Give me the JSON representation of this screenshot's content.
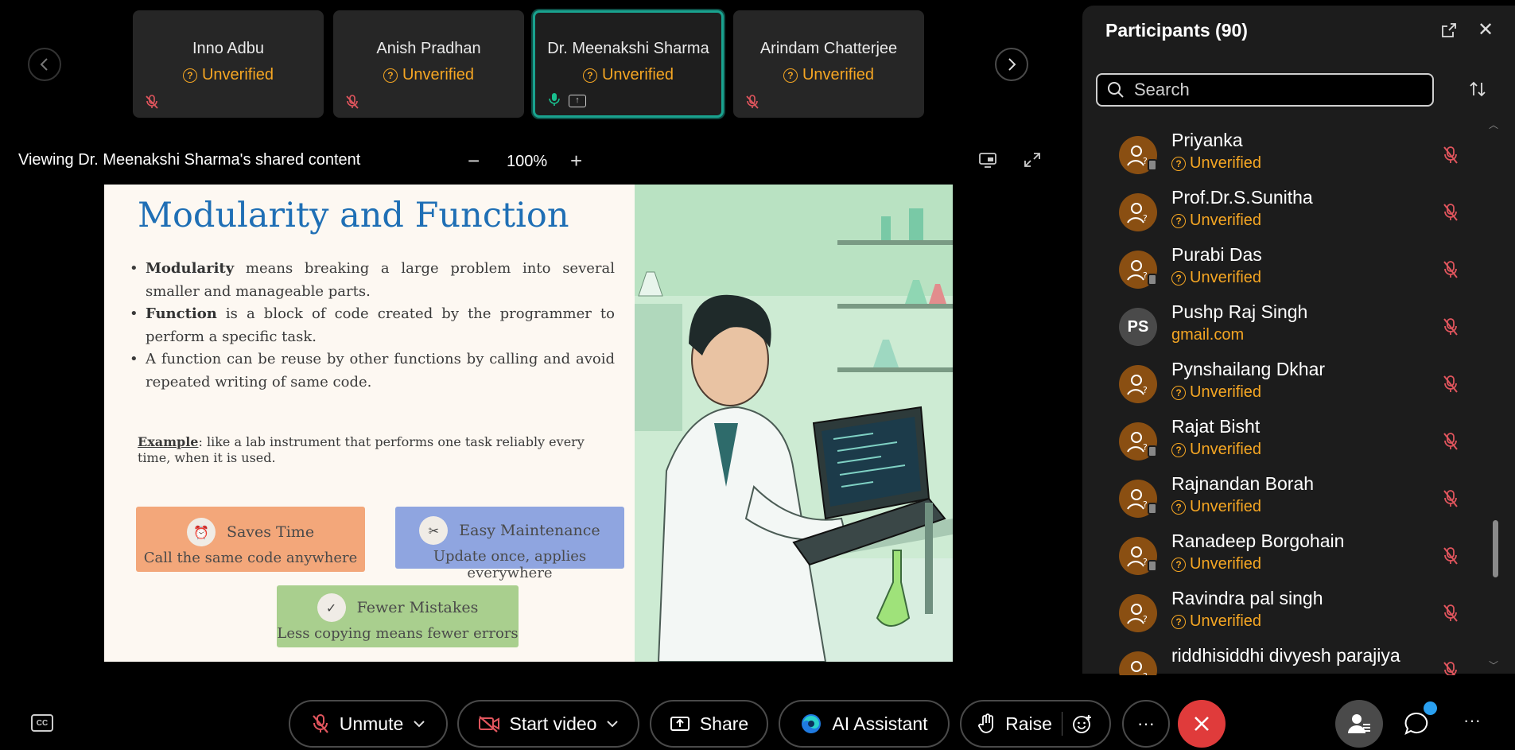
{
  "video_strip": {
    "tiles": [
      {
        "name": "Inno Adbu",
        "status": "Unverified"
      },
      {
        "name": "Anish Pradhan",
        "status": "Unverified"
      },
      {
        "name": "Dr. Meenakshi Sharma",
        "status": "Unverified"
      },
      {
        "name": "Arindam Chatterjee",
        "status": "Unverified"
      }
    ]
  },
  "share_header": {
    "title": "Viewing Dr. Meenakshi Sharma's shared content",
    "zoom": "100%",
    "zoom_minus": "−",
    "zoom_plus": "+"
  },
  "slide": {
    "title": "Modularity  and Function",
    "bullets": [
      {
        "bold": "Modularity",
        "text": " means breaking a large problem into several smaller and manageable parts."
      },
      {
        "bold": "Function",
        "text": " is a block of code created by the programmer to perform a specific task."
      },
      {
        "bold": "",
        "text": "A function can be reuse by other functions by calling and avoid repeated writing of same code."
      }
    ],
    "example_label": "Example",
    "example_text": ": like a lab instrument that performs one task reliably every time, when it is used.",
    "cards": [
      {
        "title": "Saves Time",
        "subtitle": "Call the same code anywhere"
      },
      {
        "title": "Easy Maintenance",
        "subtitle": "Update once, applies everywhere"
      },
      {
        "title": "Fewer Mistakes",
        "subtitle": "Less copying means fewer errors"
      }
    ]
  },
  "participants": {
    "title": "Participants (90)",
    "search_placeholder": "Search",
    "list": [
      {
        "name": "Priyanka",
        "status": "Unverified",
        "initials": "",
        "status_icon": true,
        "device": true
      },
      {
        "name": "Prof.Dr.S.Sunitha",
        "status": "Unverified",
        "initials": "",
        "status_icon": true,
        "device": false
      },
      {
        "name": "Purabi Das",
        "status": "Unverified",
        "initials": "",
        "status_icon": true,
        "device": true
      },
      {
        "name": "Pushp Raj Singh",
        "status": "gmail.com",
        "initials": "PS",
        "status_icon": false,
        "device": false
      },
      {
        "name": "Pynshailang Dkhar",
        "status": "Unverified",
        "initials": "",
        "status_icon": true,
        "device": false
      },
      {
        "name": "Rajat Bisht",
        "status": "Unverified",
        "initials": "",
        "status_icon": true,
        "device": true
      },
      {
        "name": "Rajnandan Borah",
        "status": "Unverified",
        "initials": "",
        "status_icon": true,
        "device": true
      },
      {
        "name": "Ranadeep Borgohain",
        "status": "Unverified",
        "initials": "",
        "status_icon": true,
        "device": true
      },
      {
        "name": "Ravindra pal singh",
        "status": "Unverified",
        "initials": "",
        "status_icon": true,
        "device": false
      },
      {
        "name": "riddhisiddhi divyesh parajiya",
        "status": "",
        "initials": "",
        "status_icon": false,
        "device": false
      }
    ]
  },
  "toolbar": {
    "cc": "CC",
    "unmute": "Unmute",
    "start_video": "Start video",
    "share": "Share",
    "ai_assistant": "AI Assistant",
    "raise": "Raise",
    "more": "···",
    "overflow": "···"
  },
  "colors": {
    "accent_teal": "#19a38f",
    "unverified_orange": "#f5a623",
    "leave_red": "#e03b3b",
    "slide_title_blue": "#1f6fb5"
  }
}
